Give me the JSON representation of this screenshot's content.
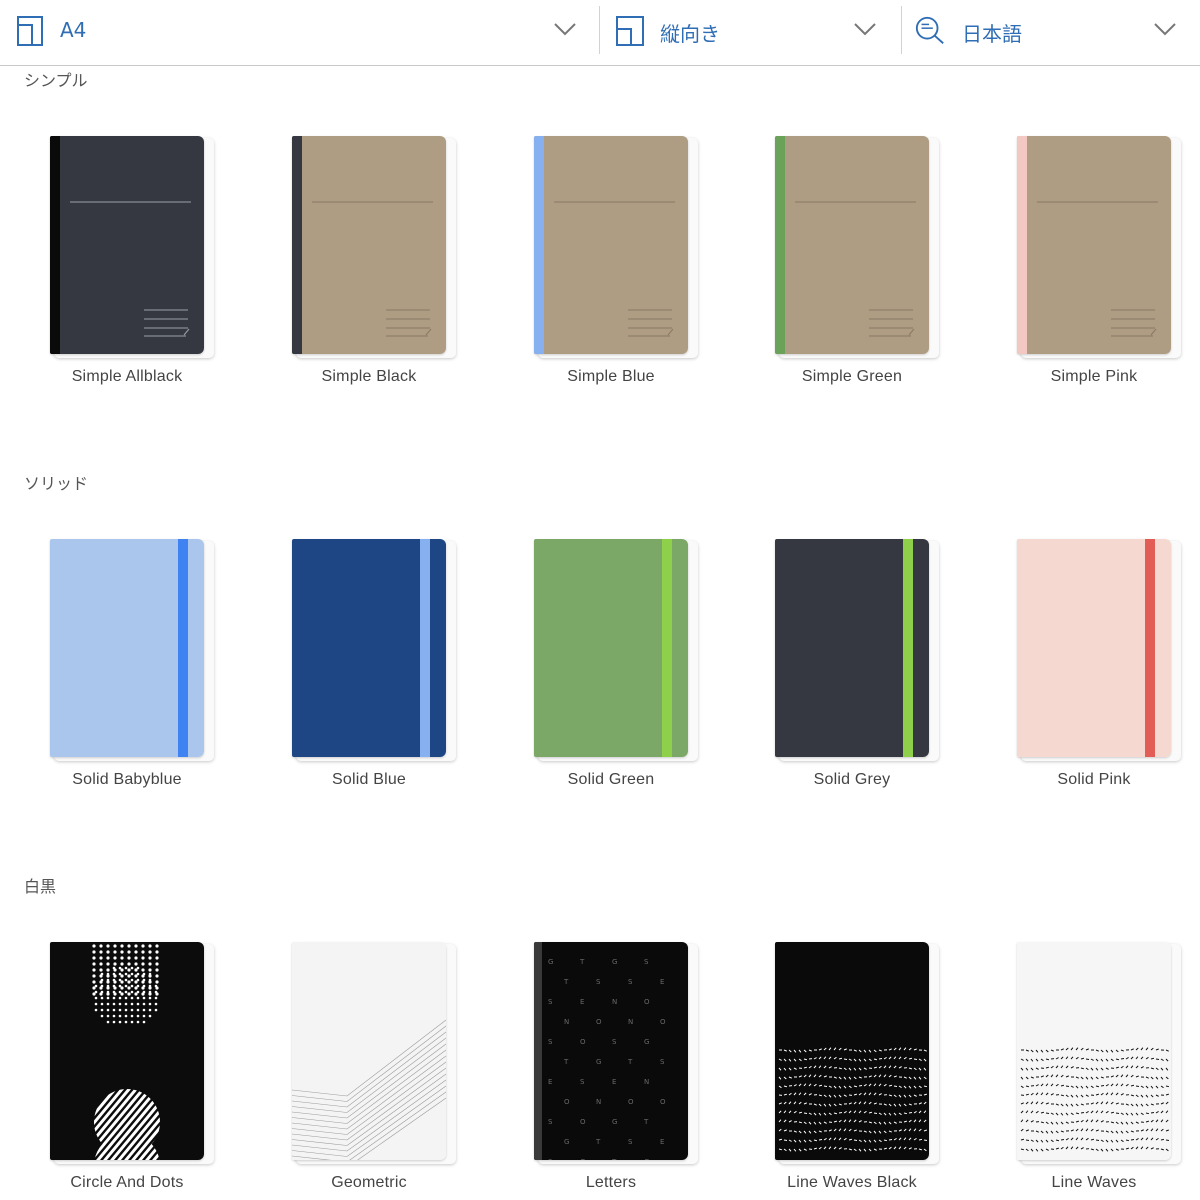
{
  "toolbar": {
    "size": {
      "label": "A4",
      "icon": "page-size-icon"
    },
    "orientation": {
      "label": "縦向き",
      "icon": "orientation-icon"
    },
    "language": {
      "label": "日本語",
      "icon": "language-search-icon"
    },
    "accent": "#2f6db5"
  },
  "sections": [
    {
      "title": "シンプル",
      "covers": [
        {
          "name": "Simple Allblack",
          "style": "simple",
          "body": "#353840",
          "spine": "#0a0a0a",
          "line": "#9aa0aa"
        },
        {
          "name": "Simple Black",
          "style": "simple",
          "body": "#ae9c83",
          "spine": "#353840",
          "line": "#8a7a64"
        },
        {
          "name": "Simple Blue",
          "style": "simple",
          "body": "#ae9c83",
          "spine": "#86b0f0",
          "line": "#8a7a64"
        },
        {
          "name": "Simple Green",
          "style": "simple",
          "body": "#ae9c83",
          "spine": "#6aa25a",
          "line": "#8a7a64"
        },
        {
          "name": "Simple Pink",
          "style": "simple",
          "body": "#ae9c83",
          "spine": "#f3c7c2",
          "line": "#8a7a64"
        }
      ]
    },
    {
      "title": "ソリッド",
      "covers": [
        {
          "name": "Solid Babyblue",
          "style": "solid",
          "body": "#aac6ec",
          "band": "#3f82f2",
          "edge": "#aac6ec"
        },
        {
          "name": "Solid Blue",
          "style": "solid",
          "body": "#1f4684",
          "band": "#86b0f0",
          "edge": "#1f4684"
        },
        {
          "name": "Solid Green",
          "style": "solid",
          "body": "#7ca867",
          "band": "#8ed04a",
          "edge": "#7ca867"
        },
        {
          "name": "Solid Grey",
          "style": "solid",
          "body": "#353840",
          "band": "#8ed04a",
          "edge": "#353840"
        },
        {
          "name": "Solid Pink",
          "style": "solid",
          "body": "#f5d8cf",
          "band": "#e15d55",
          "edge": "#f5d8cf"
        }
      ]
    },
    {
      "title": "白黒",
      "covers": [
        {
          "name": "Circle And Dots",
          "style": "circles",
          "body": "#0c0c0c"
        },
        {
          "name": "Geometric",
          "style": "geometric",
          "body": "#f4f4f4"
        },
        {
          "name": "Letters",
          "style": "letters",
          "body": "#0a0a0a",
          "letters": [
            "G",
            "T",
            "G",
            "S",
            "T",
            "S",
            "S",
            "E",
            "S",
            "E",
            "N",
            "O",
            "N",
            "O",
            "N",
            "O",
            "S",
            "O",
            "S",
            "G",
            "T",
            "G",
            "T",
            "S",
            "E",
            "S",
            "E",
            "N",
            "O",
            "N",
            "O",
            "O",
            "S",
            "O",
            "G",
            "T",
            "G",
            "T",
            "S",
            "E",
            "S"
          ]
        },
        {
          "name": "Line Waves Black",
          "style": "waves",
          "body": "#0a0a0a",
          "mark": "#ffffff"
        },
        {
          "name": "Line Waves",
          "style": "waves",
          "body": "#f6f6f6",
          "mark": "#111111"
        }
      ]
    }
  ]
}
